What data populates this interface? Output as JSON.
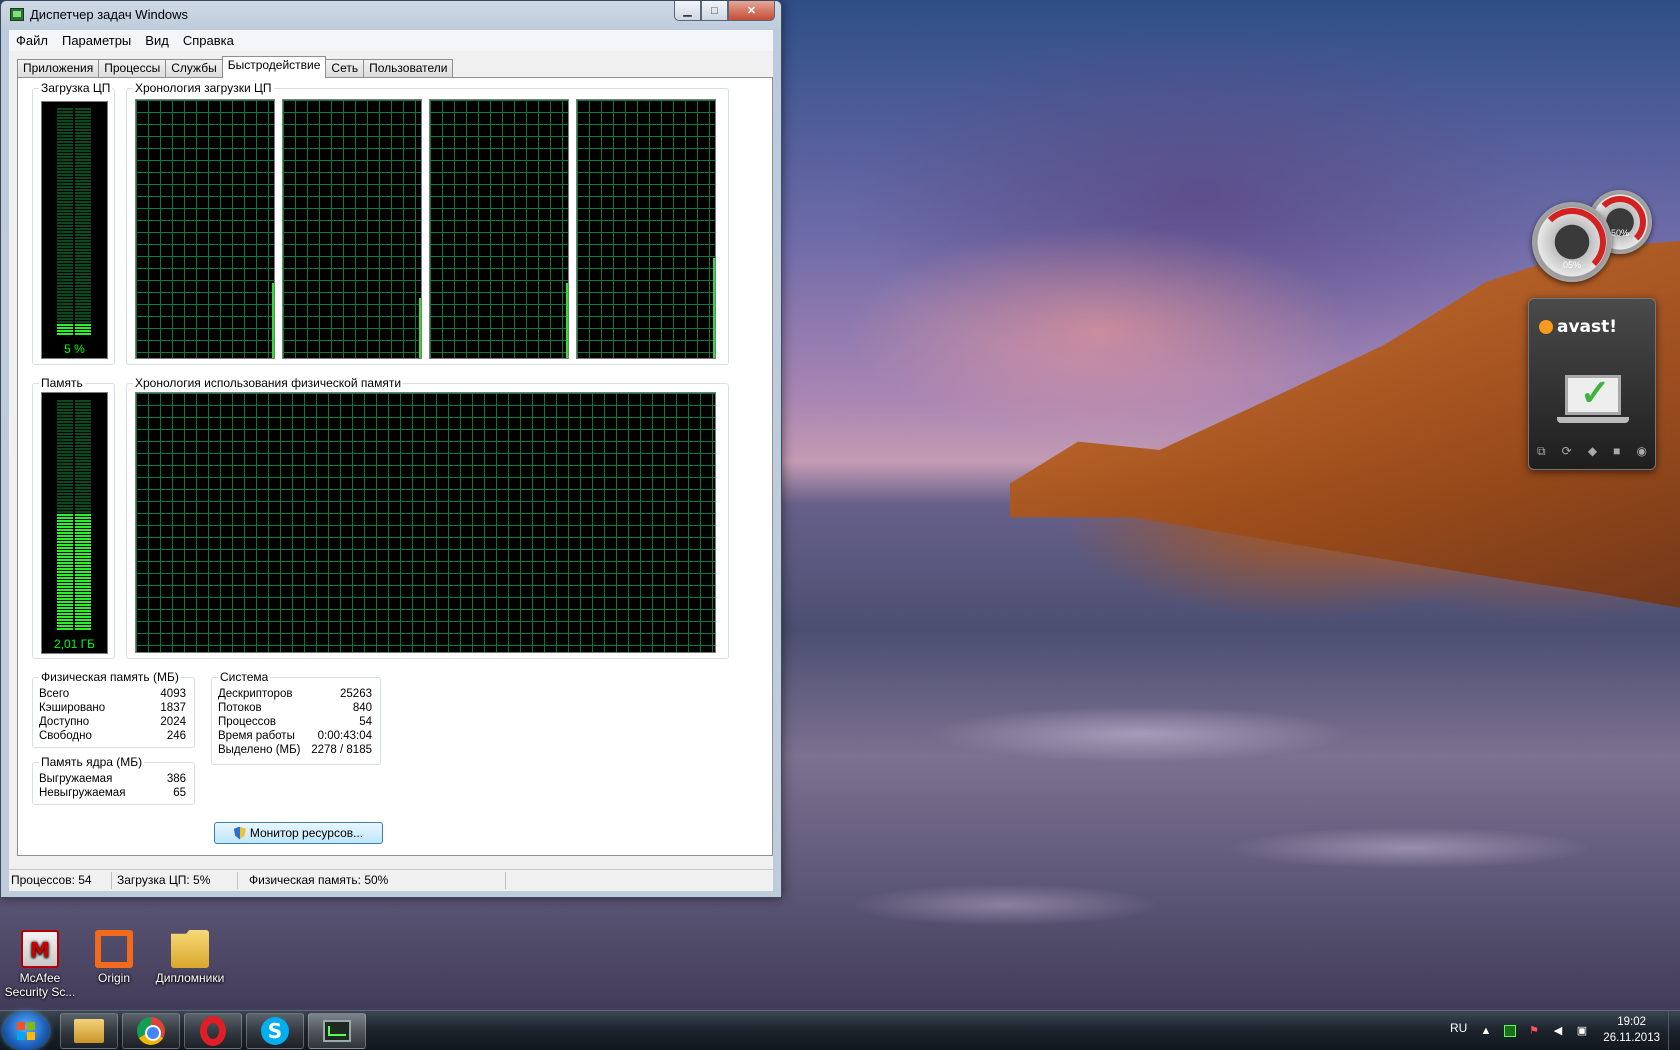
{
  "window": {
    "title": "Диспетчер задач Windows",
    "buttons": {
      "minimize": "▁",
      "maximize": "□",
      "close": "✕"
    }
  },
  "menu": [
    "Файл",
    "Параметры",
    "Вид",
    "Справка"
  ],
  "tabs": [
    {
      "label": "Приложения",
      "active": false
    },
    {
      "label": "Процессы",
      "active": false
    },
    {
      "label": "Службы",
      "active": false
    },
    {
      "label": "Быстродействие",
      "active": true
    },
    {
      "label": "Сеть",
      "active": false
    },
    {
      "label": "Пользователи",
      "active": false
    }
  ],
  "performance": {
    "cpu_usage": {
      "title": "Загрузка ЦП",
      "value_label": "5 %",
      "fraction": 0.05
    },
    "cpu_history": {
      "title": "Хронология загрузки ЦП",
      "cores": 4
    },
    "memory": {
      "title": "Память",
      "value_label": "2,01 ГБ",
      "fraction": 0.5
    },
    "memory_history": {
      "title": "Хронология использования физической памяти"
    },
    "physical_memory": {
      "title": "Физическая память (МБ)",
      "rows": [
        {
          "label": "Всего",
          "value": "4093"
        },
        {
          "label": "Кэшировано",
          "value": "1837"
        },
        {
          "label": "Доступно",
          "value": "2024"
        },
        {
          "label": "Свободно",
          "value": "246"
        }
      ]
    },
    "kernel_memory": {
      "title": "Память ядра (МБ)",
      "rows": [
        {
          "label": "Выгружаемая",
          "value": "386"
        },
        {
          "label": "Невыгружаемая",
          "value": "65"
        }
      ]
    },
    "system": {
      "title": "Система",
      "rows": [
        {
          "label": "Дескрипторов",
          "value": "25263"
        },
        {
          "label": "Потоков",
          "value": "840"
        },
        {
          "label": "Процессов",
          "value": "54"
        },
        {
          "label": "Время работы",
          "value": "0:00:43:04"
        },
        {
          "label": "Выделено (МБ)",
          "value": "2278 / 8185"
        }
      ]
    },
    "resource_monitor_button": "Монитор ресурсов..."
  },
  "statusbar": {
    "processes": "Процессов: 54",
    "cpu": "Загрузка ЦП: 5%",
    "memory": "Физическая память: 50%"
  },
  "desktop_icons": [
    {
      "label": "McAfee Security Sc...",
      "icon": "mcafee-icon"
    },
    {
      "label": "Origin",
      "icon": "origin-icon"
    },
    {
      "label": "Дипломники",
      "icon": "folder-icon"
    }
  ],
  "gadgets": {
    "cpu_meter": {
      "small_value": "50%",
      "large_value": "05%"
    },
    "avast": {
      "brand": "avast!"
    }
  },
  "taskbar": {
    "pinned": [
      "explorer-icon",
      "chrome-icon",
      "opera-icon",
      "skype-icon",
      "task-manager-icon"
    ],
    "language": "RU",
    "time": "19:02",
    "date": "26.11.2013"
  }
}
